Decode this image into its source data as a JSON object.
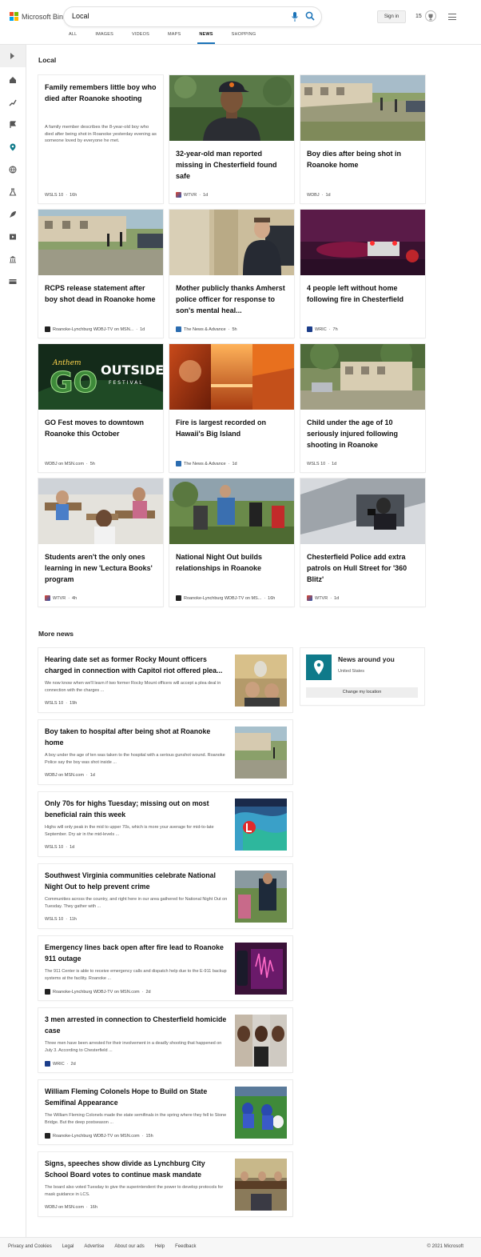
{
  "header": {
    "brand": "Microsoft Bing",
    "query": "Local",
    "signin": "Sign in",
    "points": "15"
  },
  "tabs": [
    {
      "label": "ALL"
    },
    {
      "label": "IMAGES"
    },
    {
      "label": "VIDEOS"
    },
    {
      "label": "MAPS"
    },
    {
      "label": "NEWS"
    },
    {
      "label": "SHOPPING"
    }
  ],
  "local": {
    "title": "Local",
    "cards": [
      {
        "title": "Family remembers little boy who died after Roanoke shooting",
        "desc": "A family member describes the 8-year-old boy who died after being shot in Roanoke yesterday evening as someone loved by everyone he met.",
        "source": "WSLS 10",
        "time": "16h"
      },
      {
        "title": "32-year-old man reported missing in Chesterfield found safe",
        "source": "WTVR",
        "time": "1d"
      },
      {
        "title": "Boy dies after being shot in Roanoke home",
        "source": "WDBJ",
        "time": "1d"
      },
      {
        "title": "RCPS release statement after boy shot dead in Roanoke home",
        "source": "Roanoke-Lynchburg WDBJ-TV on MSN...",
        "time": "1d"
      },
      {
        "title": "Mother publicly thanks Amherst police officer for response to son's mental heal...",
        "source": "The News & Advance",
        "time": "5h"
      },
      {
        "title": "4 people left without home following fire in Chesterfield",
        "source": "WRIC",
        "time": "7h"
      },
      {
        "title": "GO Fest moves to downtown Roanoke this October",
        "source": "WDBJ on MSN.com",
        "time": "5h"
      },
      {
        "title": "Fire is largest recorded on Hawaii's Big Island",
        "source": "The News & Advance",
        "time": "1d"
      },
      {
        "title": "Child under the age of 10 seriously injured following shooting in Roanoke",
        "source": "WSLS 10",
        "time": "1d"
      },
      {
        "title": "Students aren't the only ones learning in new 'Lectura Books' program",
        "source": "WTVR",
        "time": "4h"
      },
      {
        "title": "National Night Out builds relationships in Roanoke",
        "source": "Roanoke-Lynchburg WDBJ-TV on MS...",
        "time": "16h"
      },
      {
        "title": "Chesterfield Police add extra patrols on Hull Street for '360 Blitz'",
        "source": "WTVR",
        "time": "1d"
      }
    ],
    "gofest": {
      "top": "Anthem",
      "go": "GO",
      "outside": "OUTSIDE",
      "festival": "FESTIVAL"
    }
  },
  "more_news": {
    "title": "More news",
    "items": [
      {
        "title": "Hearing date set as former Rocky Mount officers charged in connection with Capitol riot offered plea...",
        "desc": "We now know when we'll learn if two former Rocky Mount officers will accept a plea deal in connection with the charges ...",
        "source": "WSLS 10",
        "time": "19h"
      },
      {
        "title": "Boy taken to hospital after being shot at Roanoke home",
        "desc": "A boy under the age of ten was taken to the hospital with a serious gunshot wound. Roanoke Police say the boy was shot inside ...",
        "source": "WDBJ on MSN.com",
        "time": "1d"
      },
      {
        "title": "Only 70s for highs Tuesday; missing out on most beneficial rain this week",
        "desc": "Highs will only peak in the mid to upper 70s, which is more your average for mid-to-late September. Dry air in the mid-levels ...",
        "source": "WSLS 10",
        "time": "1d"
      },
      {
        "title": "Southwest Virginia communities celebrate National Night Out to help prevent crime",
        "desc": "Communities across the country, and right here in our area gathered for National Night Out on Tuesday. They gather with ...",
        "source": "WSLS 10",
        "time": "11h"
      },
      {
        "title": "Emergency lines back open after fire lead to Roanoke 911 outage",
        "desc": "The 911 Center is able to receive emergency calls and dispatch help due to the E-911 backup systems at the facility. Roanoke ...",
        "source": "Roanoke-Lynchburg WDBJ-TV on MSN.com",
        "time": "2d"
      },
      {
        "title": "3 men arrested in connection to Chesterfield homicide case",
        "desc": "Three men have been arrested for their involvement in a deadly shooting that happened on July 3. According to Chesterfield ...",
        "source": "WRIC",
        "time": "2d"
      },
      {
        "title": "William Fleming Colonels Hope to Build on State Semifinal Appearance",
        "desc": "The William Fleming Colonels made the state semifinals in the spring where they fell to Stone Bridge. But the deep postseason ...",
        "source": "Roanoke-Lynchburg WDBJ-TV on MSN.com",
        "time": "15h"
      },
      {
        "title": "Signs, speeches show divide as Lynchburg City School Board votes to continue mask mandate",
        "desc": "The board also voted Tuesday to give the superintendent the power to develop protocols for mask guidance in LCS.",
        "source": "WDBJ on MSN.com",
        "time": "16h"
      }
    ]
  },
  "location": {
    "title": "News around you",
    "sub": "United States",
    "button": "Change my location"
  },
  "footer": {
    "links": [
      "Privacy and Cookies",
      "Legal",
      "Advertise",
      "About our ads",
      "Help",
      "Feedback"
    ],
    "copyright": "© 2021 Microsoft"
  },
  "colors": {
    "accent": "#1a73b8",
    "pin": "#0f7a8a"
  }
}
